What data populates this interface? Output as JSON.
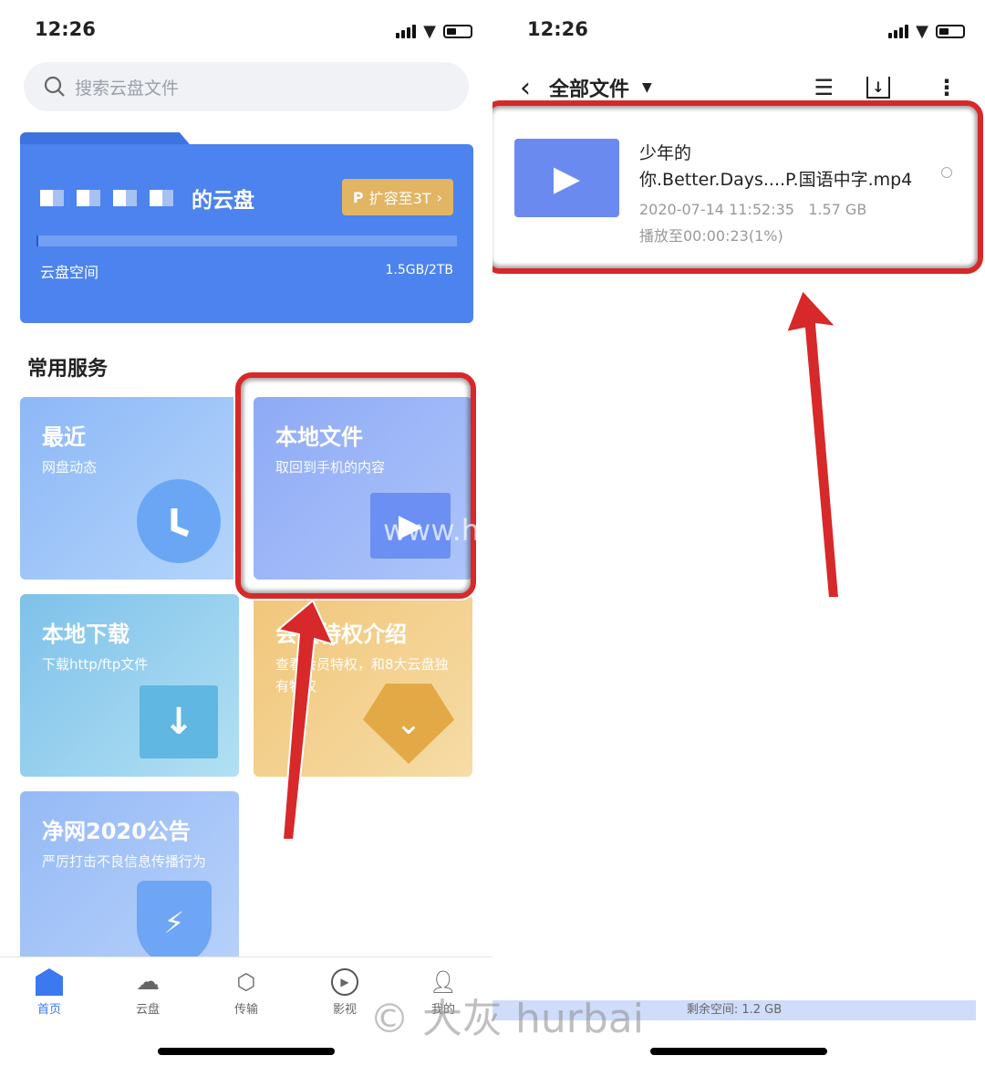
{
  "left": {
    "status": {
      "time": "12:26"
    },
    "search": {
      "placeholder": "搜索云盘文件",
      "icon": "search-icon"
    },
    "disk": {
      "title_suffix": "的云盘",
      "expand_label": "扩容至3T",
      "storage_label": "云盘空间",
      "storage_value": "1.5GB/2TB",
      "usage_fraction": 0.00075
    },
    "section_title": "常用服务",
    "services": [
      {
        "title": "最近",
        "subtitle": "网盘动态",
        "icon": "clock-icon"
      },
      {
        "title": "本地文件",
        "subtitle": "取回到手机的内容",
        "icon": "folder-play-icon"
      },
      {
        "title": "本地下载",
        "subtitle": "下载http/ftp文件",
        "icon": "download-icon"
      },
      {
        "title": "会员特权介绍",
        "subtitle": "查看会员特权，和8大云盘独有特权",
        "icon": "diamond-icon"
      },
      {
        "title": "净网2020公告",
        "subtitle": "严厉打击不良信息传播行为",
        "icon": "shield-bolt-icon"
      }
    ],
    "tabs": [
      {
        "label": "首页",
        "icon": "home-icon",
        "active": true
      },
      {
        "label": "云盘",
        "icon": "cloud-icon"
      },
      {
        "label": "传输",
        "icon": "transfer-icon"
      },
      {
        "label": "影视",
        "icon": "play-circle-icon"
      },
      {
        "label": "我的",
        "icon": "user-icon"
      }
    ]
  },
  "right": {
    "status": {
      "time": "12:26"
    },
    "nav": {
      "title": "全部文件"
    },
    "file": {
      "name_line1": "少年的",
      "name_line2": "你.Better.Days....P.国语中字.mp4",
      "date": "2020-07-14 11:52:35",
      "size": "1.57 GB",
      "progress": "播放至00:00:23(1%)"
    },
    "free_space": "剩余空间: 1.2 GB"
  },
  "watermarks": {
    "url": "www.hurbai.com",
    "copyright": "© 大灰 hurbai"
  },
  "colors": {
    "accent": "#3c78ef",
    "annotation": "#d7282a",
    "disk_card": "#4c83ee",
    "expand_button": "#e2b563"
  }
}
